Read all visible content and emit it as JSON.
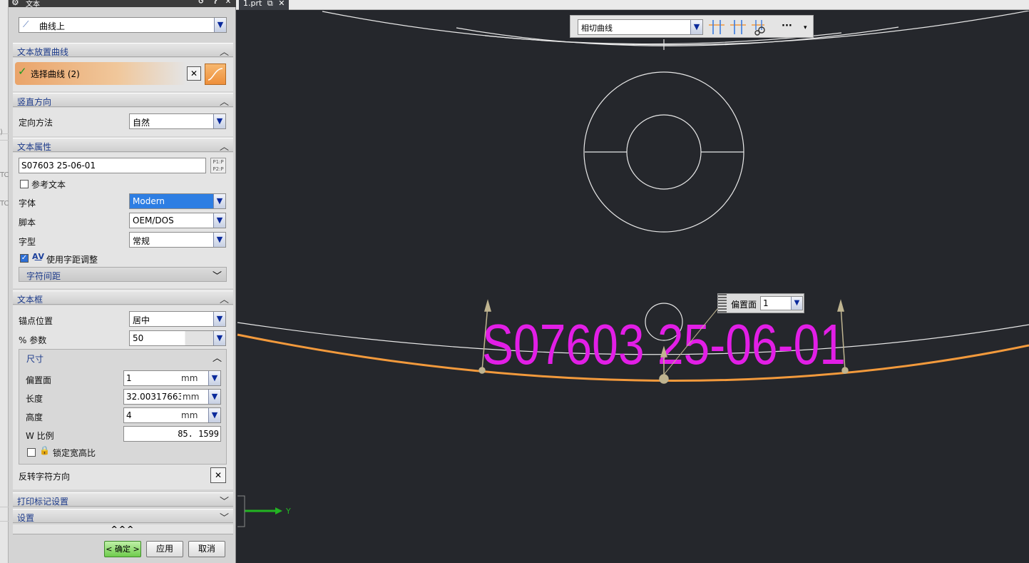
{
  "dialog": {
    "title": "文本",
    "type_value": "曲线上",
    "sections": {
      "placement_curve": "文本放置曲线",
      "vertical_direction": "竖直方向",
      "text_properties": "文本属性",
      "text_box": "文本框",
      "print_mark": "打印标记设置",
      "settings": "设置"
    },
    "select_curve": "选择曲线 (2)",
    "orientation_label": "定向方法",
    "orientation_value": "自然",
    "text_value": "S07603 25-06-01",
    "ref_text_label": "参考文本",
    "font_label": "字体",
    "font_value": "Modern",
    "script_label": "脚本",
    "script_value": "OEM/DOS",
    "style_label": "字型",
    "style_value": "常规",
    "kerning_label": "使用字距调整",
    "char_spacing_label": "字符间距",
    "anchor_label": "锚点位置",
    "anchor_value": "居中",
    "param_label": "% 参数",
    "param_value": "50",
    "size_label": "尺寸",
    "offset_label": "偏置面",
    "offset_value": "1",
    "length_label": "长度",
    "length_value": "32.00317663",
    "height_label": "高度",
    "height_value": "4",
    "unit": "mm",
    "w_ratio_label": "W 比例",
    "w_ratio_value": "85. 1599",
    "lock_label": "锁定宽高比",
    "reverse_label": "反转字符方向",
    "more": "^^^",
    "ok": "< 确定 >",
    "apply": "应用",
    "cancel": "取消"
  },
  "tab": {
    "label": "1.prt"
  },
  "toolbar": {
    "curve_value": "相切曲线",
    "more": "···"
  },
  "viewport": {
    "text_preview": "S07603 25-06-01",
    "offset_label": "偏置面",
    "offset_value": "1",
    "axis_label": "Y"
  },
  "colors": {
    "accent_orange": "#f39a3c",
    "text_magenta": "#e21ee6",
    "handle": "#bfb490"
  },
  "icons": [
    "arrow-curve-icon",
    "check-icon",
    "deselect-icon",
    "curve-icon",
    "text-box-icon",
    "kerning-icon",
    "lock-icon",
    "reset-icon",
    "help-icon",
    "close-icon"
  ]
}
